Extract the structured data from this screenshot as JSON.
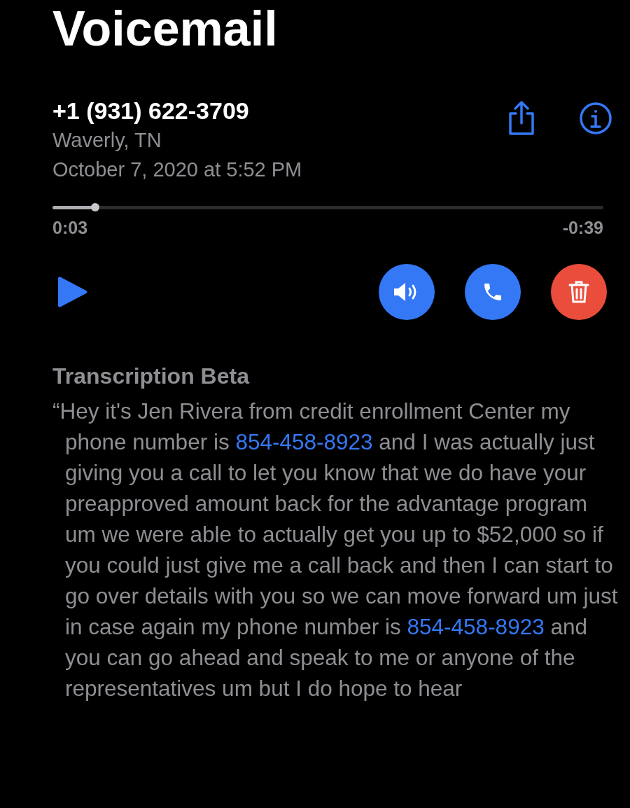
{
  "title": "Voicemail",
  "caller": {
    "number": "+1 (931) 622-3709",
    "location": "Waverly, TN",
    "date": "October 7, 2020 at 5:52 PM"
  },
  "playback": {
    "level": 0.077,
    "elapsed": "0:03",
    "remaining": "-0:39"
  },
  "actions": [
    {
      "kind": "speaker",
      "color": "#3478f6"
    },
    {
      "kind": "call",
      "color": "#3478f6"
    },
    {
      "kind": "delete",
      "color": "#eb4d3d"
    }
  ],
  "transcription": {
    "heading": "Transcription Beta",
    "segments": [
      {
        "kind": "text",
        "text": "“Hey it's Jen Rivera from credit enrollment Center my phone number is "
      },
      {
        "kind": "link",
        "text": "854-458-8923"
      },
      {
        "kind": "text",
        "text": " and I was actually just giving you a call to let you know that we do have your preapproved amount back for the advantage program um we were able to actually get you up to $52,000 so if you could just give me a call back and then I can start to go over details with you so we can move forward um just in case again my phone number is "
      },
      {
        "kind": "link",
        "text": "854-458-8923"
      },
      {
        "kind": "text",
        "text": " and you can go ahead and speak to me or anyone of the representatives um but I do hope to hear"
      }
    ]
  }
}
